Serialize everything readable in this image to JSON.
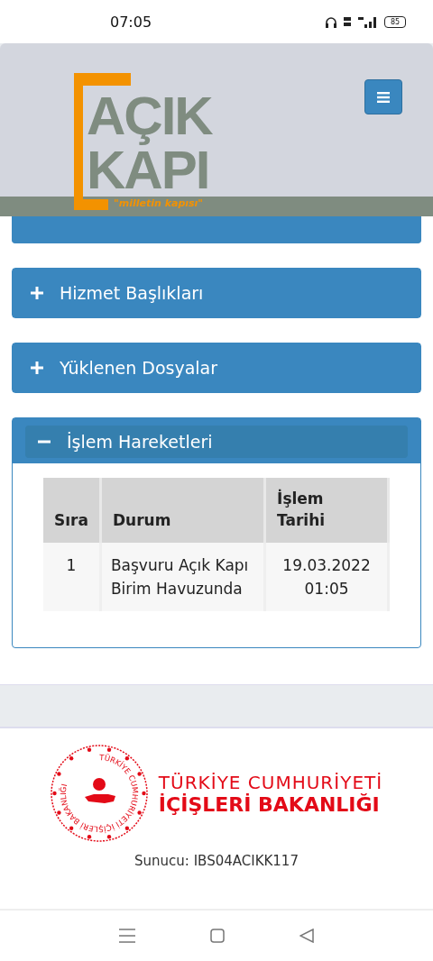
{
  "status_bar": {
    "time": "07:05",
    "battery": "85"
  },
  "header": {
    "logo": {
      "line1": "AÇIK",
      "line2": "KAPI",
      "tagline": "\"milletin kapısı\""
    }
  },
  "panels": [
    {
      "expanded": false
    },
    {
      "title": "Hizmet Başlıkları",
      "expanded": false
    },
    {
      "title": "Yüklenen Dosyalar",
      "expanded": false
    },
    {
      "title": "İşlem Hareketleri",
      "expanded": true,
      "table": {
        "columns": [
          "Sıra",
          "Durum",
          "İşlem Tarihi"
        ],
        "rows": [
          [
            "1",
            "Başvuru Açık Kapı Birim Havuzunda",
            "19.03.2022 01:05"
          ]
        ]
      }
    }
  ],
  "footer": {
    "seal_text": "TÜRKİYE CUMHURİYETİ İÇİŞLERİ BAKANLIĞI",
    "org_line1": "TÜRKİYE CUMHURİYETİ",
    "org_line2": "İÇİŞLERİ BAKANLIĞI",
    "server": "Sunucu: IBS04ACIKK117"
  }
}
